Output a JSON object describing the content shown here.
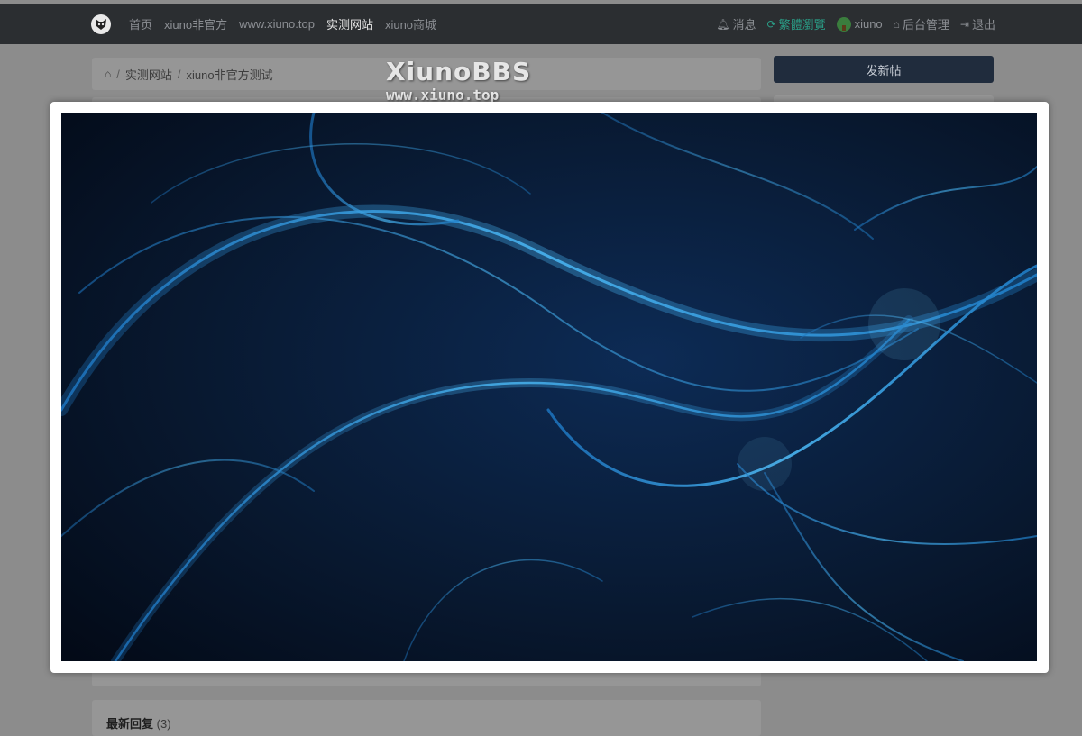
{
  "nav": {
    "left_items": [
      {
        "label": "首页"
      },
      {
        "label": "xiuno非官方"
      },
      {
        "label": "www.xiuno.top"
      },
      {
        "label": "实测网站",
        "active": true
      },
      {
        "label": "xiuno商城"
      }
    ],
    "right_items": {
      "messages": "消息",
      "traditional": "繁體瀏覽",
      "user": "xiuno",
      "admin": "后台管理",
      "logout": "退出"
    }
  },
  "breadcrumb": {
    "items": [
      "实测网站",
      "xiuno非官方测试"
    ]
  },
  "sidebar": {
    "post_button": "发新帖"
  },
  "watermark": {
    "line1": "XiunoBBS",
    "line2": "www.xiuno.top"
  },
  "replies": {
    "title": "最新回复",
    "count": "(3)"
  },
  "colors": {
    "navbar": "#2b2e31",
    "accent": "#2a9d86",
    "post_button": "#202c3d"
  }
}
